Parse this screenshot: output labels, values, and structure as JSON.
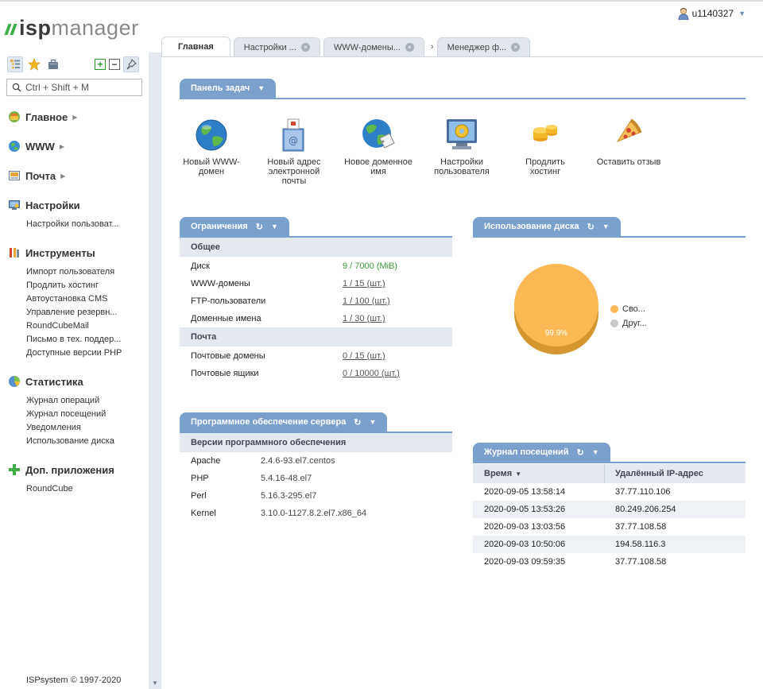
{
  "app": {
    "logo_isp": "isp",
    "logo_manager": "manager",
    "user": "u1140327",
    "copyright": "ISPsystem © 1997-2020"
  },
  "sidebar": {
    "search_placeholder": "Ctrl + Shift + M",
    "groups": [
      {
        "label": "Главное",
        "icon": "home-icon",
        "items": []
      },
      {
        "label": "WWW",
        "icon": "globe-icon",
        "items": []
      },
      {
        "label": "Почта",
        "icon": "mail-icon",
        "items": []
      },
      {
        "label": "Настройки",
        "icon": "monitor-settings-icon",
        "items": [
          "Настройки пользоват..."
        ]
      },
      {
        "label": "Инструменты",
        "icon": "tools-icon",
        "items": [
          "Импорт пользователя",
          "Продлить хостинг",
          "Автоустановка CMS",
          "Управление резервн...",
          "RoundCubeMail",
          "Письмо в тех. поддер...",
          "Доступные версии PHP"
        ]
      },
      {
        "label": "Статистика",
        "icon": "pie-chart-icon",
        "items": [
          "Журнал операций",
          "Журнал посещений",
          "Уведомления",
          "Использование диска"
        ]
      },
      {
        "label": "Доп. приложения",
        "icon": "plus-icon",
        "items": [
          "RoundCube"
        ]
      }
    ]
  },
  "tabs": [
    {
      "label": "Главная",
      "active": true,
      "closable": false
    },
    {
      "label": "Настройки ...",
      "active": false,
      "closable": true
    },
    {
      "label": "WWW-домены...",
      "active": false,
      "closable": true
    },
    {
      "label": "Менеджер ф...",
      "active": false,
      "closable": true
    }
  ],
  "tasks_panel": {
    "title": "Панель задач",
    "tasks": [
      {
        "label": "Новый WWW-домен",
        "icon": "globe-icon"
      },
      {
        "label": "Новый адрес электронной почты",
        "icon": "mailbox-icon"
      },
      {
        "label": "Новое доменное имя",
        "icon": "globe-tag-icon"
      },
      {
        "label": "Настройки пользователя",
        "icon": "monitor-gear-icon"
      },
      {
        "label": "Продлить хостинг",
        "icon": "coins-icon"
      },
      {
        "label": "Оставить отзыв",
        "icon": "pizza-icon"
      }
    ]
  },
  "limits": {
    "title": "Ограничения",
    "sections": [
      {
        "title": "Общее",
        "rows": [
          {
            "name": "Диск",
            "value": "9 / 7000 (MiB)"
          },
          {
            "name": "WWW-домены",
            "value": "1 / 15 (шт.)"
          },
          {
            "name": "FTP-пользователи",
            "value": "1 / 100 (шт.)"
          },
          {
            "name": "Доменные имена",
            "value": "1 / 30 (шт.)"
          }
        ]
      },
      {
        "title": "Почта",
        "rows": [
          {
            "name": "Почтовые домены",
            "value": "0 / 15 (шт.)"
          },
          {
            "name": "Почтовые ящики",
            "value": "0 / 10000 (шт.)"
          }
        ]
      }
    ]
  },
  "software": {
    "title": "Программное обеспечение сервера",
    "section": "Версии программного обеспечения",
    "rows": [
      {
        "name": "Apache",
        "value": "2.4.6-93.el7.centos"
      },
      {
        "name": "PHP",
        "value": "5.4.16-48.el7"
      },
      {
        "name": "Perl",
        "value": "5.16.3-295.el7"
      },
      {
        "name": "Kernel",
        "value": "3.10.0-1127.8.2.el7.x86_64"
      }
    ]
  },
  "disk": {
    "title": "Использование диска",
    "slice_label": "99.9%",
    "colors": {
      "free": "#fbb955",
      "other": "#c8c8c8"
    },
    "legend": [
      {
        "label": "Сво...",
        "color": "#fbb955"
      },
      {
        "label": "Друг...",
        "color": "#c8c8c8"
      }
    ]
  },
  "visits": {
    "title": "Журнал посещений",
    "columns": [
      "Время",
      "Удалённый IP-адрес"
    ],
    "rows": [
      [
        "2020-09-05 13:58:14",
        "37.77.110.106"
      ],
      [
        "2020-09-05 13:53:26",
        "80.249.206.254"
      ],
      [
        "2020-09-03 13:03:56",
        "37.77.108.58"
      ],
      [
        "2020-09-03 10:50:06",
        "194.58.116.3"
      ],
      [
        "2020-09-03 09:59:35",
        "37.77.108.58"
      ]
    ]
  }
}
